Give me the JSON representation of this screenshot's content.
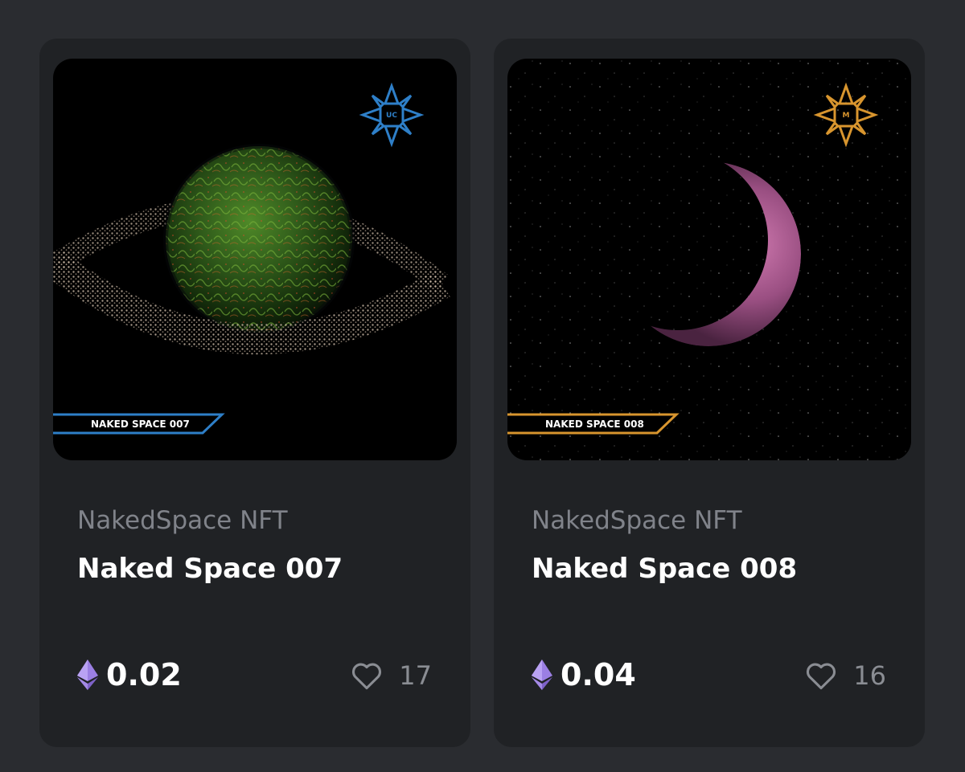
{
  "cards": [
    {
      "collection": "NakedSpace NFT",
      "title": "Naked Space 007",
      "artwork_label": "NAKED SPACE 007",
      "badge": "UC",
      "accent_color": "#2e7fc8",
      "price": "0.02",
      "likes": "17",
      "artwork": "ringed green planet"
    },
    {
      "collection": "NakedSpace NFT",
      "title": "Naked Space 008",
      "artwork_label": "NAKED SPACE 008",
      "badge": "M",
      "accent_color": "#d8952e",
      "price": "0.04",
      "likes": "16",
      "artwork": "pink crescent planet"
    }
  ],
  "icons": {
    "currency": "ethereum-icon",
    "like": "heart-outline-icon"
  },
  "colors": {
    "page_bg": "#2a2c30",
    "card_bg": "#202225",
    "eth_purple": "#9b7fe3"
  }
}
